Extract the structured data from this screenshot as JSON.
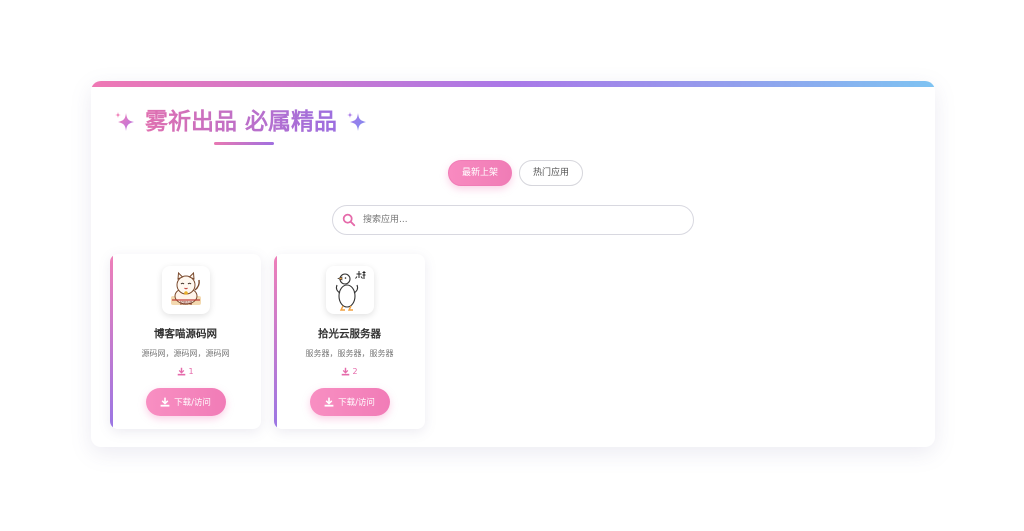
{
  "header": {
    "title": "雾祈出品 必属精品",
    "sparkle_icon": "sparkle-icon",
    "accent_gradient": [
      "#ef78b4",
      "#a978e8",
      "#7ec3f2"
    ]
  },
  "tabs": [
    {
      "label": "最新上架",
      "active": true
    },
    {
      "label": "热门应用",
      "active": false
    }
  ],
  "search": {
    "placeholder": "搜索应用...",
    "value": "",
    "icon": "search-icon"
  },
  "apps": [
    {
      "name": "博客喵源码网",
      "description": "源码网，源码网，源码网",
      "downloads": "1",
      "button_label": "下载/访问",
      "icon": "lucky-cat-icon"
    },
    {
      "name": "拾光云服务器",
      "description": "服务器，服务器，服务器",
      "downloads": "2",
      "button_label": "下载/访问",
      "icon": "goose-icon"
    }
  ],
  "colors": {
    "primary_pink": "#f07cb6",
    "purple": "#9c6fe0",
    "text_dark": "#333333"
  }
}
